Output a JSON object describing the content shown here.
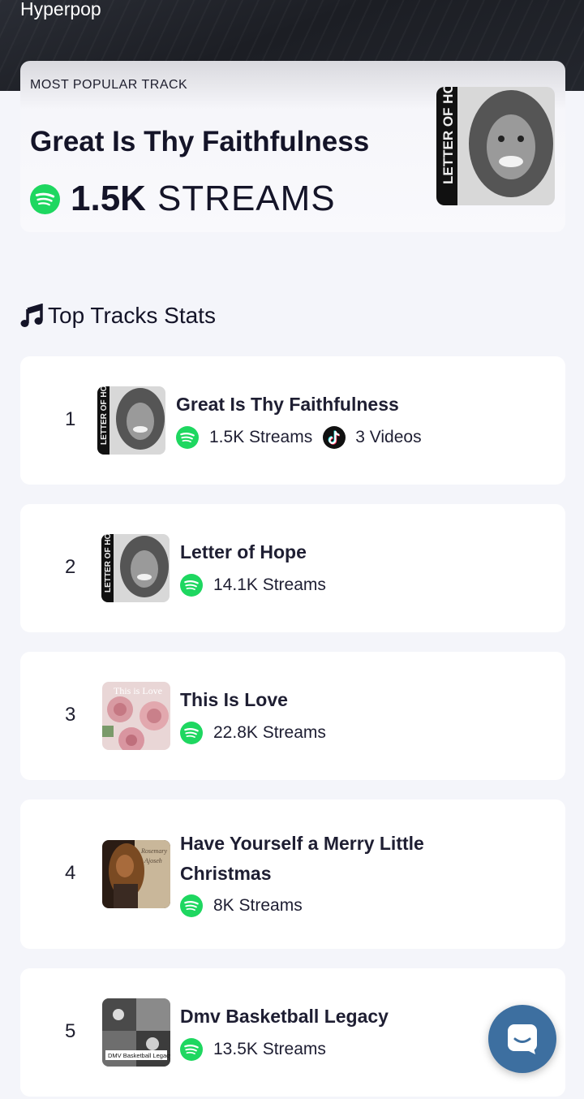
{
  "hero": {
    "genre": "Hyperpop"
  },
  "popular": {
    "label": "MOST POPULAR TRACK",
    "title": "Great Is Thy Faithfulness",
    "streams_value": "1.5K",
    "streams_word": "STREAMS",
    "art_icon": "album-cover-letter-of-hope"
  },
  "section": {
    "title": "Top Tracks Stats",
    "icon": "music-note-icon"
  },
  "tracks": [
    {
      "rank": "1",
      "title": "Great Is Thy Faithfulness",
      "streams": "1.5K Streams",
      "videos": "3 Videos",
      "art": "letter-of-hope"
    },
    {
      "rank": "2",
      "title": "Letter of Hope",
      "streams": "14.1K Streams",
      "art": "letter-of-hope"
    },
    {
      "rank": "3",
      "title": "This Is Love",
      "streams": "22.8K Streams",
      "art": "this-is-love"
    },
    {
      "rank": "4",
      "title": "Have Yourself a Merry Little Christmas",
      "streams": "8K Streams",
      "art": "merry-christmas"
    },
    {
      "rank": "5",
      "title": "Dmv Basketball Legacy",
      "streams": "13.5K Streams",
      "art": "dmv-basketball-legacy"
    }
  ],
  "colors": {
    "spotify": "#1ed760",
    "tiktok": "#111111",
    "chat": "#3d6fa0",
    "card": "#ffffff",
    "page": "#f4f5fa"
  },
  "chat": {
    "icon": "chat-icon"
  }
}
